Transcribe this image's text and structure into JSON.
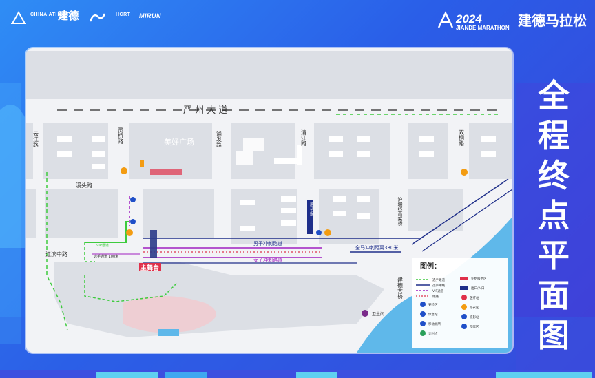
{
  "header": {
    "sponsors": [
      "CHINA ATHLETICS",
      "建德",
      "HCRT",
      "MIRUN"
    ],
    "brand_year": "2024",
    "brand_name": "建德马拉松",
    "brand_subtitle": "JIANDE MARATHON"
  },
  "side_title": [
    "全",
    "程",
    "终",
    "点",
    "平",
    "面",
    "图"
  ],
  "map": {
    "roads": {
      "main_avenue": "严 州 大 道",
      "lingqiao_road": "灵桥路",
      "pufa_road": "浦发路",
      "qingjiang_road": "清江路",
      "shuangtong_road": "双桐路",
      "yunjiang_road": "云江路",
      "xitou_road": "溪头路",
      "jiangbin_road": "江滨中路",
      "huruihang_bridge": "沪瑞线高架桥",
      "jiande_bridge": "建德大桥"
    },
    "places": {
      "meihao_square": "美好广场",
      "main_stage": "主舞台",
      "toilet": "卫生间",
      "sign_vertical": "滨江东路",
      "sign_small": "终点"
    },
    "route_labels": {
      "men_sprint": "男子冲刺路道",
      "women_sprint": "女子冲刺路道",
      "full_marathon_distance": "全马冲刺距离380米",
      "vip_lane": "VIP通道",
      "athlete_lane": "选手通道 100米"
    },
    "legend": {
      "title": "图例：",
      "items": [
        "选手路道",
        "选手冲线",
        "VIP通道",
        "线路",
        "安检区",
        "休息站",
        "移动厕所",
        "计时点"
      ],
      "items_right": [
        "补给服务区",
        "出口/入口",
        "医疗站",
        "存衣区",
        "摄影站",
        "停车区"
      ]
    },
    "colors": {
      "background": "#f2f3f6",
      "block": "#dcdfe5",
      "river": "#5fb8ea",
      "green_route": "#3ecb3e",
      "purple_route": "#a020c0",
      "red_route": "#e0304a",
      "navy_route": "#1f2f8a"
    }
  }
}
